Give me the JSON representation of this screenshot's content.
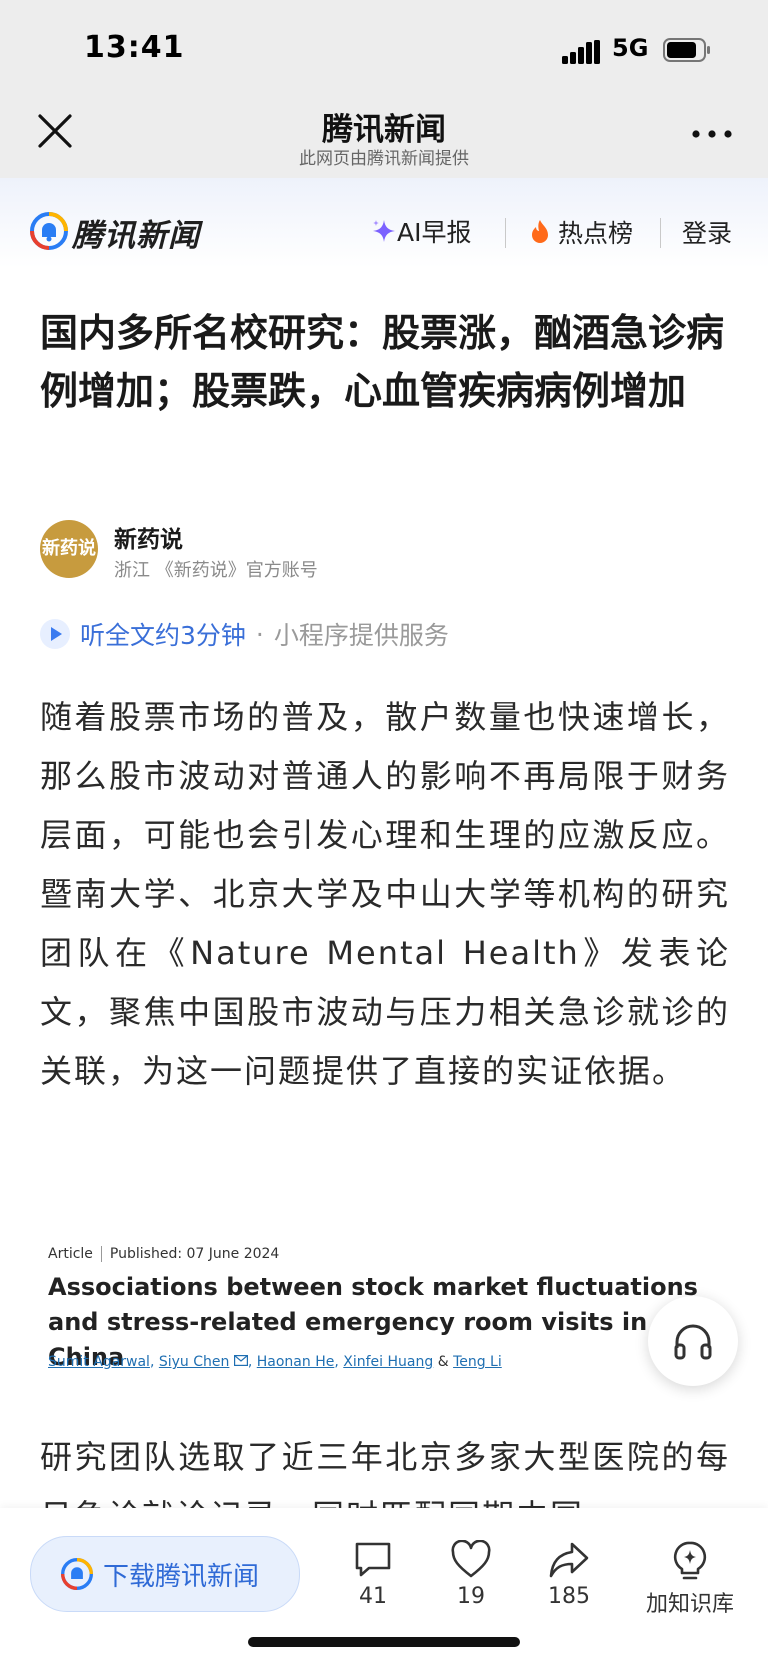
{
  "status": {
    "time": "13:41",
    "network": "5G"
  },
  "header": {
    "title": "腾讯新闻",
    "subtitle": "此网页由腾讯新闻提供"
  },
  "site_nav": {
    "brand": "腾讯新闻",
    "ai_report": "AI早报",
    "hot_list": "热点榜",
    "login": "登录"
  },
  "article": {
    "title": "国内多所名校研究：股票涨，酗酒急诊病例增加；股票跌，心血管疾病病例增加",
    "author": {
      "avatar_text": "新药说",
      "name": "新药说",
      "meta": "浙江 《新药说》官方账号"
    },
    "listen": {
      "label": "听全文约3分钟",
      "dot": "·",
      "service": "小程序提供服务"
    },
    "para1": "随着股票市场的普及，散户数量也快速增长，那么股市波动对普通人的影响不再局限于财务层面，可能也会引发心理和生理的应激反应。暨南大学、北京大学及中山大学等机构的研究团队在《Nature Mental Health》发表论文，聚焦中国股市波动与压力相关急诊就诊的关联，为这一问题提供了直接的实证依据。",
    "para2": "研究团队选取了近三年北京多家大型医院的每日急诊就诊记录，同时匹配同期中国"
  },
  "paper": {
    "type": "Article",
    "published": "Published: 07 June 2024",
    "title": "Associations between stock market fluctuations and stress-related emergency room visits in China",
    "authors": [
      "Sumit Agarwal",
      "Siyu Chen",
      "Haonan He",
      "Xinfei Huang",
      "Teng Li"
    ],
    "sep": ",",
    "amp": "&"
  },
  "bottom": {
    "download": "下载腾讯新闻",
    "comments": "41",
    "likes": "19",
    "shares": "185",
    "knowledge": "加知识库"
  },
  "colors": {
    "accent_blue": "#3a6fd8",
    "hot_orange": "#ff6a1a",
    "ai_purple": "#7b61ff",
    "avatar_gold": "#c79b3e"
  },
  "icons": [
    "close-icon",
    "more-icon",
    "signal-icon",
    "battery-icon",
    "sparkle-icon",
    "flame-icon",
    "play-icon",
    "headphones-icon",
    "comment-icon",
    "heart-icon",
    "share-icon",
    "lightbulb-icon"
  ]
}
